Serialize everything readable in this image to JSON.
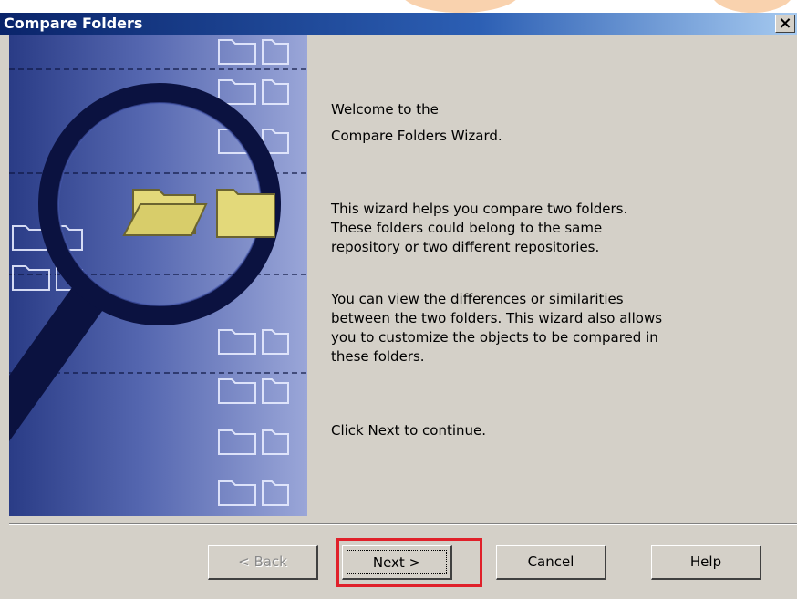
{
  "window": {
    "title": "Compare Folders",
    "close_glyph": "×"
  },
  "wizard": {
    "heading_line1": "Welcome to the",
    "heading_line2": "Compare Folders Wizard.",
    "para1_line1": "This wizard helps you compare two folders.",
    "para1_line2": "These folders could belong to the same",
    "para1_line3": "repository or two different repositories.",
    "para2_line1": "You can view the differences or similarities",
    "para2_line2": "between the two folders. This wizard also allows",
    "para2_line3": "you to customize the objects to be compared in",
    "para2_line4": "these folders.",
    "continue_text": "Click Next to continue."
  },
  "buttons": {
    "back": "< Back",
    "next": "Next >",
    "cancel": "Cancel",
    "help": "Help"
  },
  "colors": {
    "title_gradient_start": "#0a246a",
    "title_gradient_end": "#a6caf0",
    "dialog_face": "#d4d0c8",
    "panel_blue": "#3a4c96",
    "folder_yellow": "#e3d97a",
    "highlight_red": "#e0202a"
  },
  "icons": {
    "wizard_art": "magnifier-over-folders-icon",
    "close": "close-icon"
  }
}
